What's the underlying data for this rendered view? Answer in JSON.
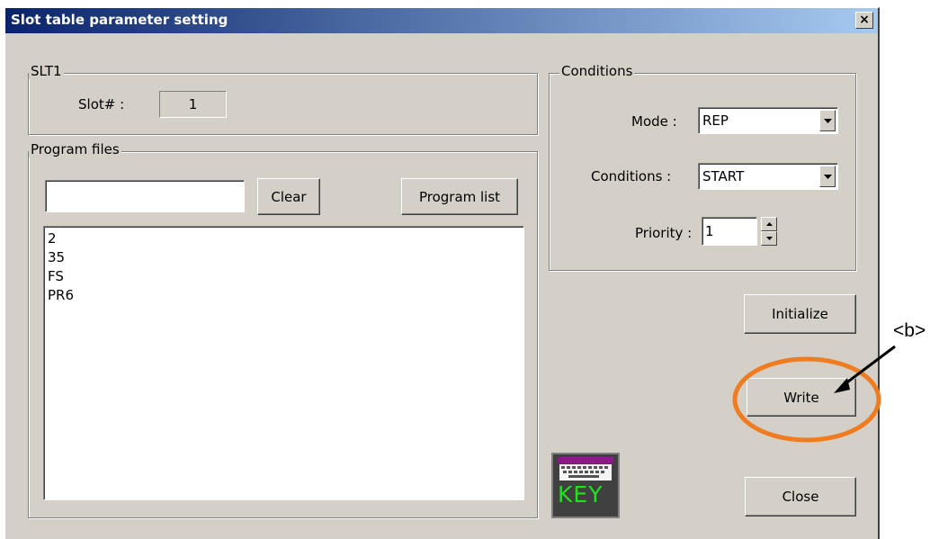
{
  "window": {
    "title": "Slot table parameter setting",
    "close_glyph": "×"
  },
  "slt_group": {
    "legend": "SLT1",
    "slot_label": "Slot# :",
    "slot_value": "1"
  },
  "program_files": {
    "legend": "Program files",
    "input_value": "",
    "clear_label": "Clear",
    "program_list_label": "Program list",
    "items": [
      "2",
      "35",
      "FS",
      "PR6"
    ]
  },
  "conditions": {
    "legend": "Conditions",
    "mode_label": "Mode :",
    "mode_value": "REP",
    "conditions_label": "Conditions :",
    "conditions_value": "START",
    "priority_label": "Priority :",
    "priority_value": "1"
  },
  "actions": {
    "initialize_label": "Initialize",
    "write_label": "Write",
    "close_label": "Close",
    "key_label": "KEY"
  },
  "annotation": {
    "callout_label": "<b>",
    "highlight_color": "#f07c22"
  },
  "icons": {
    "combo_arrow": "chevron-down-icon",
    "keyboard": "keyboard-icon"
  }
}
